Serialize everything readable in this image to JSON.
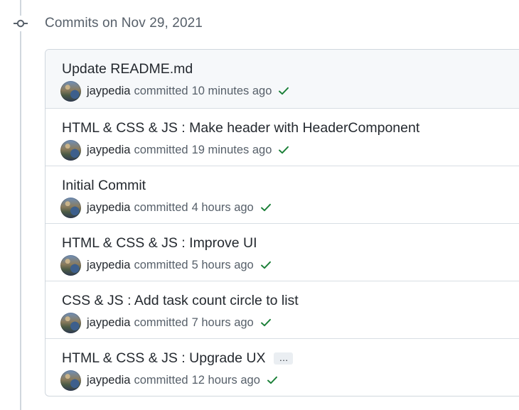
{
  "timeline": {
    "date_header": "Commits on Nov 29, 2021"
  },
  "commits": [
    {
      "title": "Update README.md",
      "author": "jaypedia",
      "committed_label": "committed",
      "time": "10 minutes ago",
      "status": "success",
      "has_ellipsis": false
    },
    {
      "title": "HTML & CSS & JS : Make header with HeaderComponent",
      "author": "jaypedia",
      "committed_label": "committed",
      "time": "19 minutes ago",
      "status": "success",
      "has_ellipsis": false
    },
    {
      "title": "Initial Commit",
      "author": "jaypedia",
      "committed_label": "committed",
      "time": "4 hours ago",
      "status": "success",
      "has_ellipsis": false
    },
    {
      "title": "HTML & CSS & JS : Improve UI",
      "author": "jaypedia",
      "committed_label": "committed",
      "time": "5 hours ago",
      "status": "success",
      "has_ellipsis": false
    },
    {
      "title": "CSS & JS : Add task count circle to list",
      "author": "jaypedia",
      "committed_label": "committed",
      "time": "7 hours ago",
      "status": "success",
      "has_ellipsis": false
    },
    {
      "title": "HTML & CSS & JS : Upgrade UX",
      "author": "jaypedia",
      "committed_label": "committed",
      "time": "12 hours ago",
      "status": "success",
      "has_ellipsis": true,
      "ellipsis_label": "…"
    }
  ],
  "icons": {
    "timeline": "git-commit-icon",
    "status": "check-icon"
  },
  "colors": {
    "success": "#1a7f37",
    "muted": "#57606a",
    "border": "#d0d7de",
    "highlight_row": "#f6f8fa"
  }
}
